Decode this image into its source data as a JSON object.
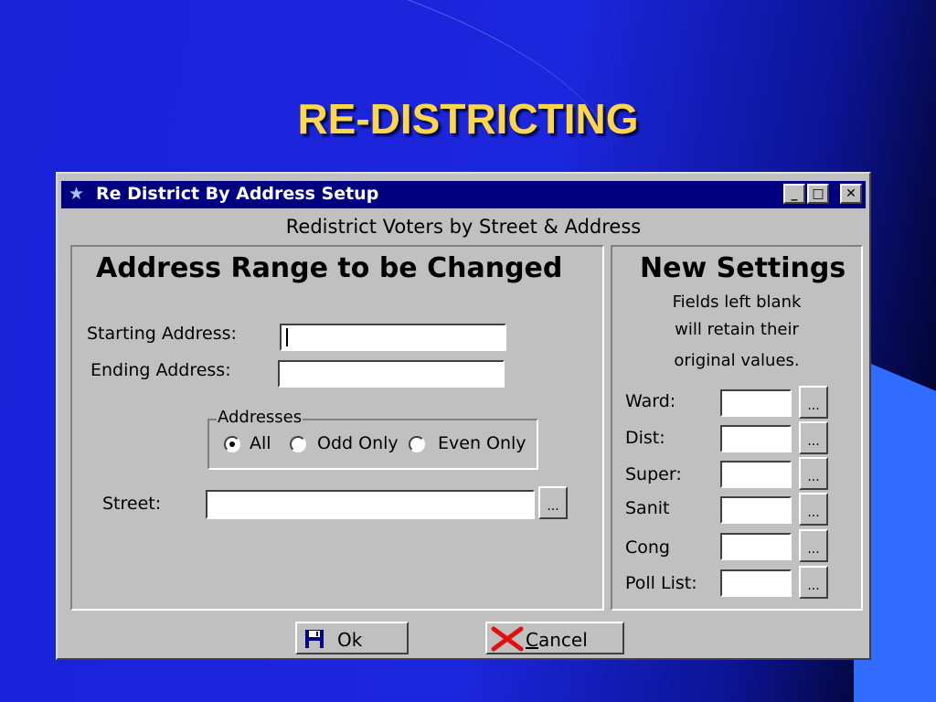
{
  "slide": {
    "title": "RE-DISTRICTING"
  },
  "window": {
    "title": "Re District By Address Setup",
    "subtitle": "Redistrict Voters by Street & Address",
    "controls": {
      "minimize": "_",
      "maximize": "□",
      "close": "✕"
    }
  },
  "address_range": {
    "heading": "Address Range to be Changed",
    "starting_label": "Starting Address:",
    "starting_value": "",
    "ending_label": "Ending Address:",
    "ending_value": "",
    "addresses_legend": "Addresses",
    "options": [
      {
        "label": "All",
        "selected": true
      },
      {
        "label": "Odd Only",
        "selected": false
      },
      {
        "label": "Even Only",
        "selected": false
      }
    ],
    "street_label": "Street:",
    "street_value": "",
    "street_lookup": "..."
  },
  "new_settings": {
    "heading": "New Settings",
    "note_lines": [
      "Fields left blank",
      "will retain their",
      "original values."
    ],
    "fields": [
      {
        "label": "Ward:",
        "value": "",
        "lookup": "..."
      },
      {
        "label": "Dist:",
        "value": "",
        "lookup": "..."
      },
      {
        "label": "Super:",
        "value": "",
        "lookup": "..."
      },
      {
        "label": "Sanit",
        "value": "",
        "lookup": "..."
      },
      {
        "label": "Cong",
        "value": "",
        "lookup": "..."
      },
      {
        "label": "Poll List:",
        "value": "",
        "lookup": "..."
      }
    ]
  },
  "buttons": {
    "ok": {
      "label": "Ok",
      "icon": "floppy-disk-icon"
    },
    "cancel": {
      "label_underlined": "C",
      "label_rest": "ancel",
      "icon": "red-x-icon"
    }
  },
  "colors": {
    "slide_title": "#ffd54a",
    "titlebar": "#000080",
    "window_face": "#c0c0c0",
    "cancel_x": "#e01010",
    "ok_icon": "#000080"
  }
}
